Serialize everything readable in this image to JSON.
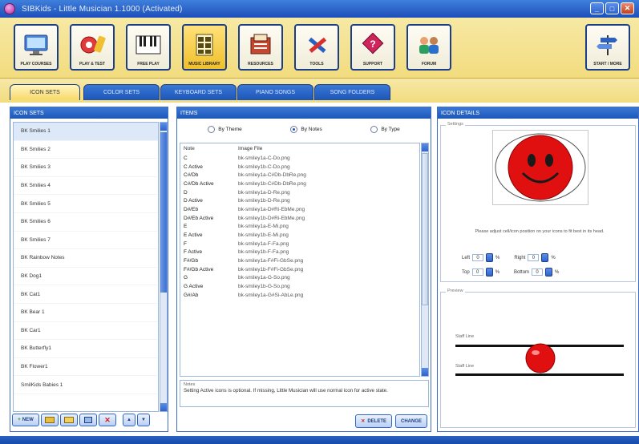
{
  "window": {
    "title": "SIBKids - Little Musician 1.1000 (Activated)"
  },
  "toolbar": {
    "buttons": [
      {
        "label": "PLAY COURSES",
        "icon": "monitor-icon"
      },
      {
        "label": "PLAY & TEST",
        "icon": "test-icon"
      },
      {
        "label": "FREE PLAY",
        "icon": "piano-icon"
      },
      {
        "label": "MUSIC LIBRARY",
        "icon": "library-icon"
      },
      {
        "label": "RESOURCES",
        "icon": "resources-icon"
      },
      {
        "label": "TOOLS",
        "icon": "tools-icon"
      },
      {
        "label": "SUPPORT",
        "icon": "support-icon"
      },
      {
        "label": "FORUM",
        "icon": "forum-icon"
      },
      {
        "label": "START / MORE",
        "icon": "signpost-icon"
      }
    ]
  },
  "tabs": [
    "ICON SETS",
    "COLOR SETS",
    "KEYBOARD SETS",
    "PIANO SONGS",
    "SONG FOLDERS"
  ],
  "iconsets": {
    "header": "ICON SETS",
    "items": [
      "BK Smilies 1",
      "BK Smilies 2",
      "BK Smilies 3",
      "BK Smilies 4",
      "BK Smilies 5",
      "BK Smilies 6",
      "BK Smilies 7",
      "BK Rainbow Notes",
      "BK Dog1",
      "BK Cat1",
      "BK Bear 1",
      "BK Car1",
      "BK Butterfly1",
      "BK Flower1",
      "SmilKids Babies 1"
    ],
    "buttons": {
      "new": "NEW"
    }
  },
  "items": {
    "header": "ITEMS",
    "radios": [
      "By Theme",
      "By Notes",
      "By Type"
    ],
    "selected_radio": "By Notes",
    "columns": [
      "Note",
      "Image File"
    ],
    "rows": [
      [
        "C",
        "bk-smiley1a-C-Do.png"
      ],
      [
        "C Active",
        "bk-smiley1b-C-Do.png"
      ],
      [
        "C#/Db",
        "bk-smiley1a-C#Db-DbRe.png"
      ],
      [
        "C#/Db Active",
        "bk-smiley1b-C#Db-DbRe.png"
      ],
      [
        "D",
        "bk-smiley1a-D-Re.png"
      ],
      [
        "D Active",
        "bk-smiley1b-D-Re.png"
      ],
      [
        "D#/Eb",
        "bk-smiley1a-D#Ri-EbMe.png"
      ],
      [
        "D#/Eb Active",
        "bk-smiley1b-D#Ri-EbMe.png"
      ],
      [
        "E",
        "bk-smiley1a-E-Mi.png"
      ],
      [
        "E Active",
        "bk-smiley1b-E-Mi.png"
      ],
      [
        "F",
        "bk-smiley1a-F-Fa.png"
      ],
      [
        "F Active",
        "bk-smiley1b-F-Fa.png"
      ],
      [
        "F#/Gb",
        "bk-smiley1a-F#Fi-GbSe.png"
      ],
      [
        "F#/Gb Active",
        "bk-smiley1b-F#Fi-GbSe.png"
      ],
      [
        "G",
        "bk-smiley1a-G-So.png"
      ],
      [
        "G Active",
        "bk-smiley1b-G-So.png"
      ],
      [
        "G#/Ab",
        "bk-smiley1a-G#Si-AbLe.png"
      ]
    ],
    "notes_label": "Notes",
    "notes": "Setting Active icons is optional. If missing, Little Musician will use normal icon for active state.",
    "buttons": {
      "delete": "DELETE",
      "change": "CHANGE"
    }
  },
  "icondetails": {
    "header": "ICON DETAILS",
    "settings_label": "Settings",
    "hint": "Please adjust cell/icon position on your icons to fit best in its head.",
    "left_label": "Left",
    "left_value": "0",
    "right_label": "Right",
    "right_value": "0",
    "top_label": "Top",
    "top_value": "0",
    "bottom_label": "Bottom",
    "bottom_value": "0",
    "unit": "%",
    "preview_label": "Preview",
    "line1_label": "Staff Line",
    "line2_label": "Staff Line"
  },
  "colors": {
    "accent_blue": "#1d56b7",
    "toolbar_yellow": "#f2dc7f",
    "smiley_red": "#e01010"
  }
}
